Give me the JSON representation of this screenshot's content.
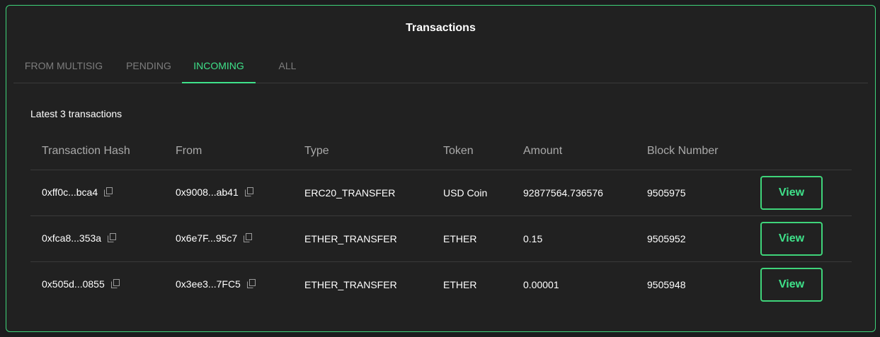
{
  "panel": {
    "title": "Transactions"
  },
  "tabs": [
    {
      "label": "FROM MULTISIG",
      "active": false
    },
    {
      "label": "PENDING",
      "active": false
    },
    {
      "label": "INCOMING",
      "active": true
    },
    {
      "label": "ALL",
      "active": false
    }
  ],
  "subtitle": "Latest 3 transactions",
  "table": {
    "columns": [
      "Transaction Hash",
      "From",
      "Type",
      "Token",
      "Amount",
      "Block Number",
      ""
    ],
    "rows": [
      {
        "hash": "0xff0c...bca4",
        "from": "0x9008...ab41",
        "type": "ERC20_TRANSFER",
        "token": "USD Coin",
        "amount": "92877564.736576",
        "block": "9505975",
        "action": "View"
      },
      {
        "hash": "0xfca8...353a",
        "from": "0x6e7F...95c7",
        "type": "ETHER_TRANSFER",
        "token": "ETHER",
        "amount": "0.15",
        "block": "9505952",
        "action": "View"
      },
      {
        "hash": "0x505d...0855",
        "from": "0x3ee3...7FC5",
        "type": "ETHER_TRANSFER",
        "token": "ETHER",
        "amount": "0.00001",
        "block": "9505948",
        "action": "View"
      }
    ]
  },
  "colors": {
    "accent": "#3fe28a",
    "border": "#3fd47a",
    "background": "#212121",
    "muted": "#7d7d7d"
  },
  "icons": {
    "copy": "copy-icon"
  }
}
